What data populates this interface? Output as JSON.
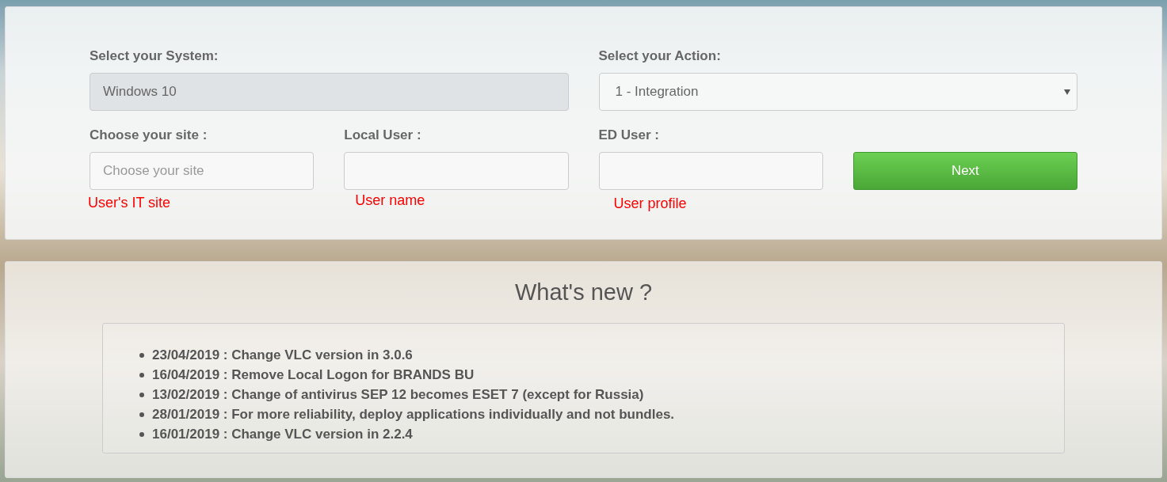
{
  "form": {
    "system": {
      "label": "Select your System:",
      "value": "Windows 10",
      "disabled": true
    },
    "action": {
      "label": "Select your Action:",
      "value": "1 - Integration"
    },
    "site": {
      "label": "Choose your site :",
      "placeholder": "Choose your site",
      "hint": "User's IT site"
    },
    "local_user": {
      "label": "Local User :",
      "hint": "User name"
    },
    "ed_user": {
      "label": "ED User :",
      "hint": "User profile"
    },
    "next_button": "Next"
  },
  "news": {
    "title": "What's new ?",
    "items": [
      "23/04/2019 : Change VLC version in 3.0.6",
      "16/04/2019 : Remove Local Logon for BRANDS BU",
      "13/02/2019 : Change of antivirus SEP 12 becomes ESET 7 (except for Russia)",
      "28/01/2019 : For more reliability, deploy applications individually and not bundles.",
      "16/01/2019 : Change VLC version in 2.2.4"
    ]
  }
}
